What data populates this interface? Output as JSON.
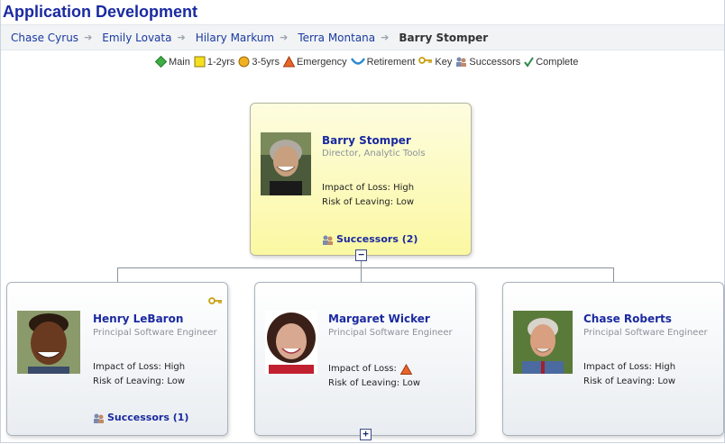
{
  "page": {
    "title": "Application Development"
  },
  "breadcrumb": {
    "items": [
      "Chase Cyrus",
      "Emily Lovata",
      "Hilary Markum",
      "Terra Montana"
    ],
    "current": "Barry Stomper"
  },
  "legend": {
    "main": "Main",
    "yrs_1_2": "1-2yrs",
    "yrs_3_5": "3-5yrs",
    "emergency": "Emergency",
    "retirement": "Retirement",
    "key": "Key",
    "successors": "Successors",
    "complete": "Complete"
  },
  "focus": {
    "name": "Barry Stomper",
    "title": "Director, Analytic Tools",
    "impact": "Impact of Loss: High",
    "risk": "Risk of Leaving: Low",
    "successors": "Successors (2)",
    "toggle": "−"
  },
  "reports": [
    {
      "name": "Henry LeBaron",
      "title": "Principal Software Engineer",
      "impact": "Impact of Loss: High",
      "risk": "Risk of Leaving: Low",
      "successors": "Successors (1)",
      "key_icon": "key-icon"
    },
    {
      "name": "Margaret Wicker",
      "title": "Principal Software Engineer",
      "impact": "Impact of Loss:",
      "impact_icon": "emergency-icon",
      "risk": "Risk of Leaving: Low",
      "toggle": "+"
    },
    {
      "name": "Chase Roberts",
      "title": "Principal Software Engineer",
      "impact": "Impact of Loss: High",
      "risk": "Risk of Leaving: Low"
    }
  ],
  "colors": {
    "link": "#1a2aa0",
    "focus_card": "#fbf8a2",
    "emergency": "#e8642a",
    "main": "#3cb043",
    "short_term": "#f5e020",
    "mid_term": "#f0b020"
  }
}
